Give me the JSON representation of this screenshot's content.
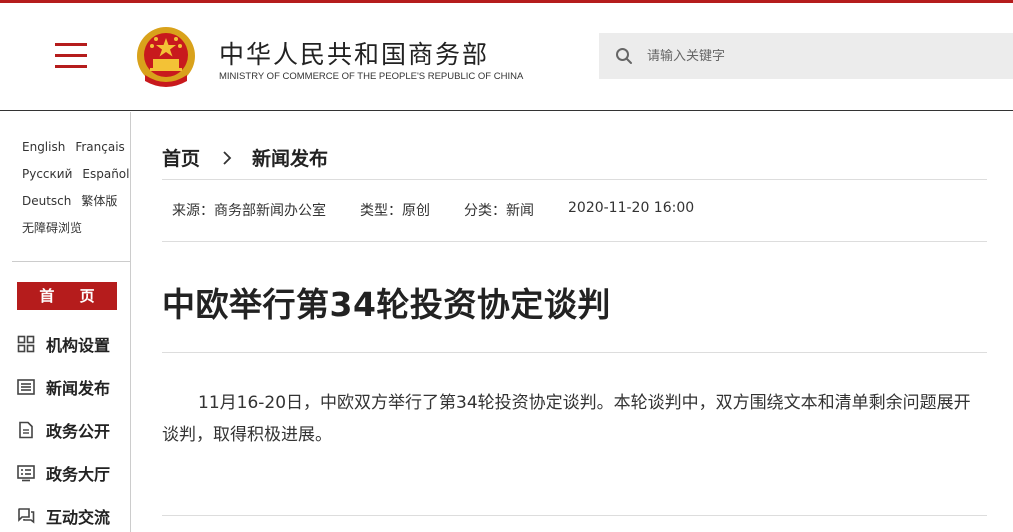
{
  "header": {
    "title_cn": "中华人民共和国商务部",
    "title_en": "MINISTRY OF COMMERCE OF THE PEOPLE'S REPUBLIC OF CHINA",
    "search_placeholder": "请输入关键字",
    "brand_color": "#b51c1c",
    "icons": [
      "menu-icon",
      "national-emblem-icon",
      "search-icon"
    ]
  },
  "sidebar": {
    "languages": [
      [
        "English",
        "Français"
      ],
      [
        "Русский",
        "Español"
      ],
      [
        "Deutsch",
        "繁体版"
      ],
      [
        "无障碍浏览"
      ]
    ],
    "home_label": "首 页",
    "nav": [
      {
        "label": "机构设置",
        "icon": "grid-icon"
      },
      {
        "label": "新闻发布",
        "icon": "news-list-icon"
      },
      {
        "label": "政务公开",
        "icon": "document-icon"
      },
      {
        "label": "政务大厅",
        "icon": "hall-list-icon"
      },
      {
        "label": "互动交流",
        "icon": "chat-icon"
      }
    ]
  },
  "main": {
    "breadcrumb": [
      "首页",
      "新闻发布"
    ],
    "meta": {
      "source": "来源：商务部新闻办公室",
      "type": "类型：原创",
      "category": "分类：新闻",
      "datetime": "2020-11-20 16:00"
    },
    "title": "中欧举行第34轮投资协定谈判",
    "body": "11月16-20日，中欧双方举行了第34轮投资协定谈判。本轮谈判中，双方围绕文本和清单剩余问题展开谈判，取得积极进展。"
  }
}
